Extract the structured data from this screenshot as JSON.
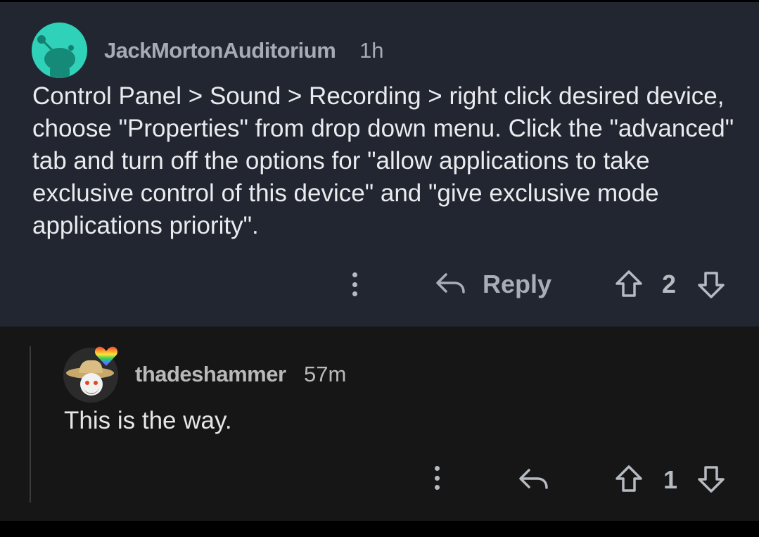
{
  "comments": [
    {
      "username": "JackMortonAuditorium",
      "time": "1h",
      "body": "Control Panel > Sound > Recording > right click desired device, choose \"Properties\" from drop down menu. Click the \"advanced\" tab and turn off the options for \"allow applications to take exclusive control of this device\" and \"give exclusive mode applications priority\".",
      "reply_label": "Reply",
      "score": "2",
      "avatar_color": "#2fd1b8"
    },
    {
      "username": "thadeshammer",
      "time": "57m",
      "body": "This is the way.",
      "score": "1"
    }
  ],
  "icons": {
    "more": "more-vertical-icon",
    "reply": "reply-arrow-icon",
    "upvote": "upvote-arrow-icon",
    "downvote": "downvote-arrow-icon",
    "badge": "rainbow-heart-icon"
  },
  "colors": {
    "top_bg": "#212630",
    "reply_bg": "#161616",
    "text": "#e9ebee",
    "meta": "#a7acb4"
  }
}
